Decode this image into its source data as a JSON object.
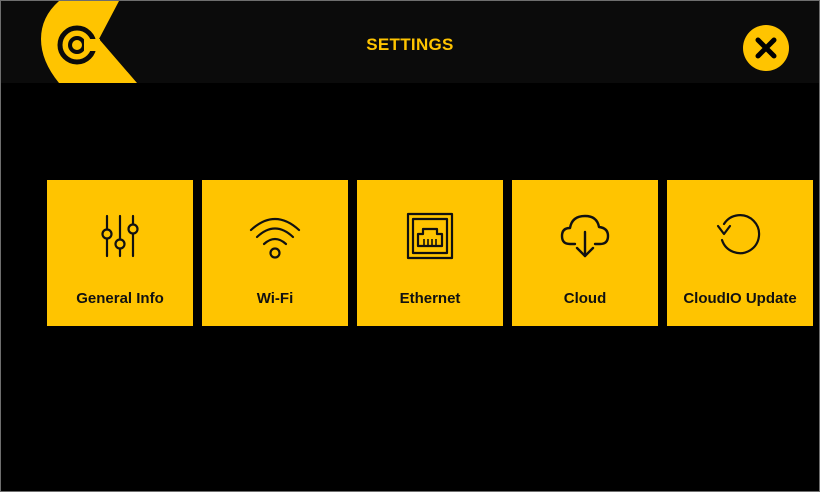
{
  "header": {
    "title": "SETTINGS",
    "logo_icon": "brand-c-logo-icon",
    "close_icon": "close-x-icon"
  },
  "colors": {
    "accent": "#ffc400",
    "background": "#000000",
    "header_background": "#0b0b0b",
    "tile_text": "#111111"
  },
  "tiles": [
    {
      "label": "General Info",
      "icon": "sliders-icon"
    },
    {
      "label": "Wi-Fi",
      "icon": "wifi-icon"
    },
    {
      "label": "Ethernet",
      "icon": "ethernet-port-icon"
    },
    {
      "label": "Cloud",
      "icon": "cloud-download-icon"
    },
    {
      "label": "CloudIO Update",
      "icon": "refresh-icon"
    }
  ]
}
